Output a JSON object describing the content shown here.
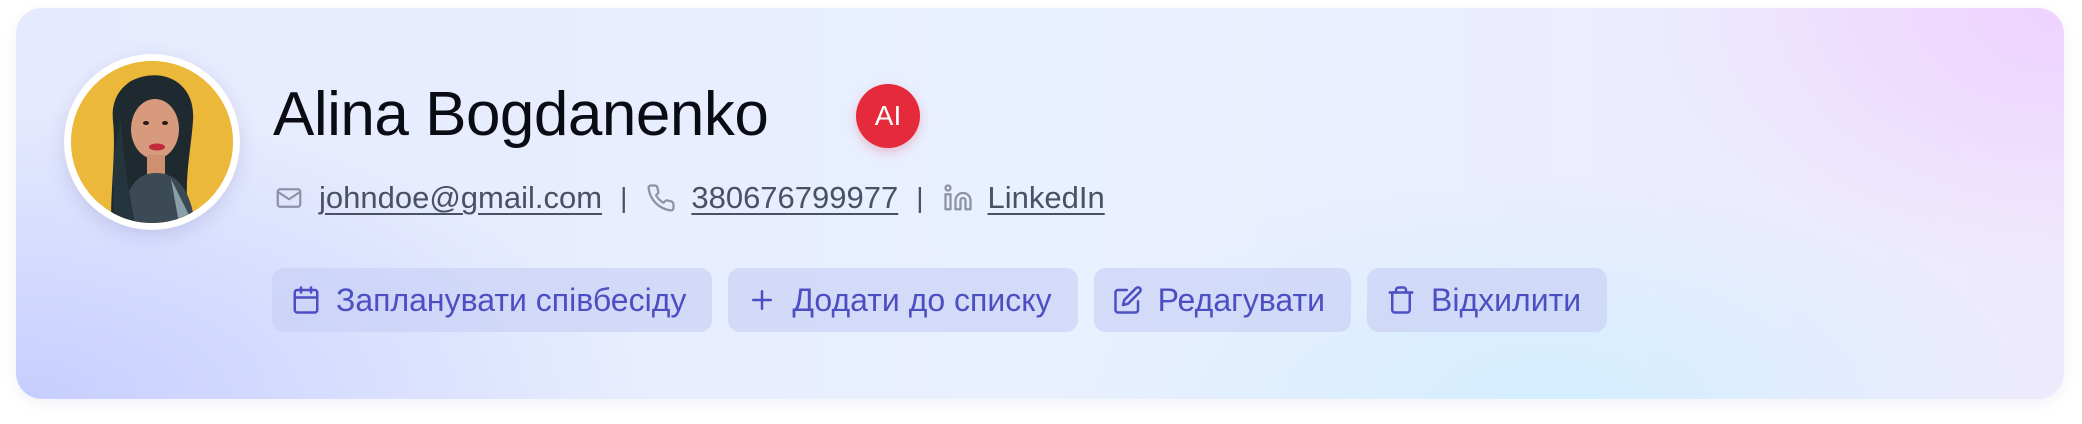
{
  "profile": {
    "name": "Alina Bogdanenko",
    "badge": "AI",
    "avatar_alt": "profile photo"
  },
  "contacts": {
    "email": "johndoe@gmail.com",
    "phone": "380676799977",
    "linkedin": "LinkedIn",
    "separator": "|"
  },
  "actions": {
    "schedule": "Запланувати співбесіду",
    "add_to_list": "Додати до списку",
    "edit": "Редагувати",
    "reject": "Відхилити"
  },
  "icons": {
    "email": "mail-icon",
    "phone": "phone-icon",
    "linkedin": "linkedin-icon",
    "schedule": "calendar-icon",
    "add_to_list": "plus-icon",
    "edit": "edit-icon",
    "reject": "trash-icon"
  },
  "colors": {
    "accent": "#4c4fc2",
    "badge": "#e52b3b",
    "text_secondary": "#4a5066"
  }
}
